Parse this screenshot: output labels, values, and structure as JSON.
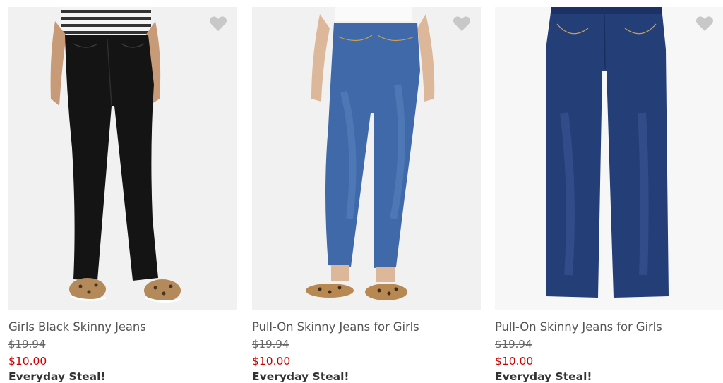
{
  "colors": {
    "title": "#555555",
    "was_price": "#666666",
    "sale_price": "#cc0000",
    "badge": "#333333",
    "heart": "#c8c8c8"
  },
  "products": [
    {
      "name": "Girls Black Skinny Jeans",
      "was_price": "$19.94",
      "sale_price": "$10.00",
      "badge": "Everyday Steal!",
      "favorite_icon": "heart-icon"
    },
    {
      "name": "Pull-On Skinny Jeans for Girls",
      "was_price": "$19.94",
      "sale_price": "$10.00",
      "badge": "Everyday Steal!",
      "favorite_icon": "heart-icon"
    },
    {
      "name": "Pull-On Skinny Jeans for Girls",
      "was_price": "$19.94",
      "sale_price": "$10.00",
      "badge": "Everyday Steal!",
      "favorite_icon": "heart-icon"
    }
  ]
}
